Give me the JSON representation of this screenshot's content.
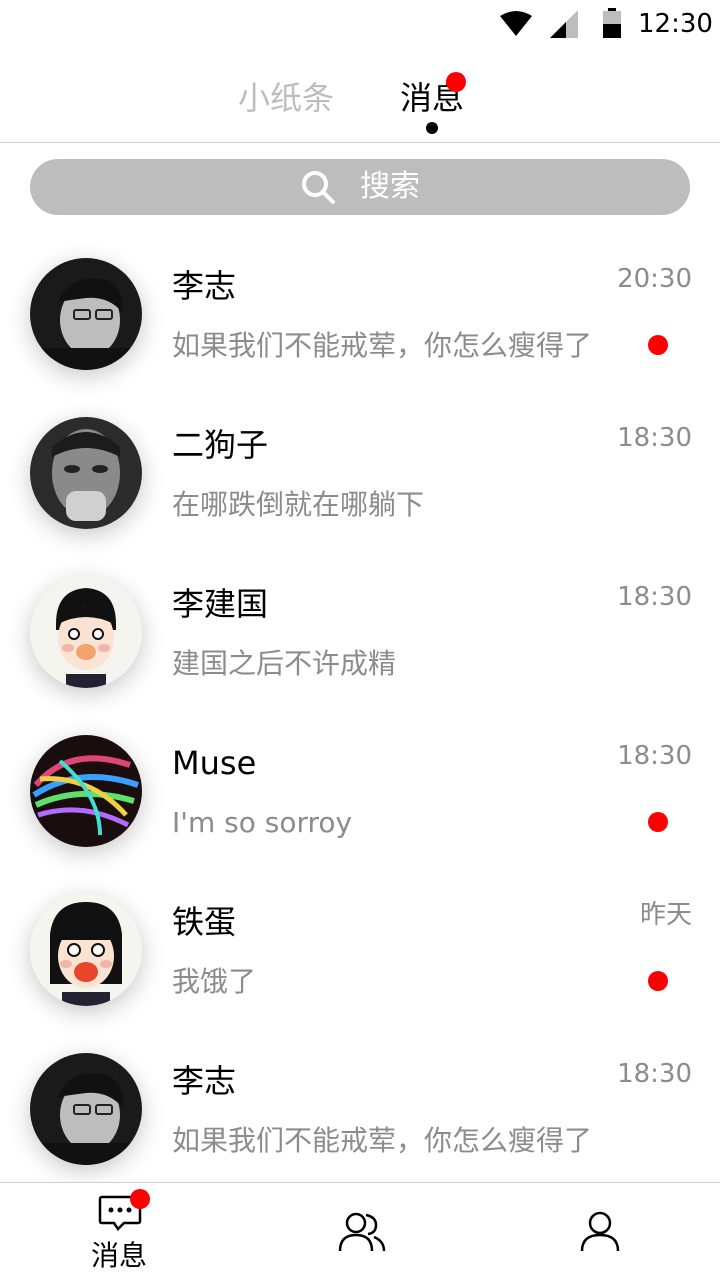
{
  "status_bar": {
    "time": "12:30"
  },
  "top_tabs": [
    {
      "label": "小纸条",
      "active": false
    },
    {
      "label": "消息",
      "active": true,
      "badge": true
    }
  ],
  "search": {
    "label": "搜索"
  },
  "conversations": [
    {
      "name": "李志",
      "time": "20:30",
      "preview": "如果我们不能戒荤，你怎么瘦得了",
      "unread": true,
      "avatar": "man-glasses-photo"
    },
    {
      "name": "二狗子",
      "time": "18:30",
      "preview": "在哪跌倒就在哪躺下",
      "unread": false,
      "avatar": "man-hand-face-photo"
    },
    {
      "name": "李建国",
      "time": "18:30",
      "preview": "建国之后不许成精",
      "unread": false,
      "avatar": "cartoon-boy"
    },
    {
      "name": "Muse",
      "time": "18:30",
      "preview": "I'm so sorroy",
      "unread": true,
      "avatar": "colorful-brain-art"
    },
    {
      "name": "铁蛋",
      "time": "昨天",
      "preview": "我饿了",
      "unread": true,
      "avatar": "cartoon-girl"
    },
    {
      "name": "李志",
      "time": "18:30",
      "preview": "如果我们不能戒荤，你怎么瘦得了",
      "unread": false,
      "avatar": "man-glasses-photo"
    }
  ],
  "bottom_nav": [
    {
      "label": "消息",
      "icon": "chat-bubble-icon",
      "badge": true,
      "active": true
    },
    {
      "label": "",
      "icon": "contacts-icon",
      "badge": false,
      "active": false
    },
    {
      "label": "",
      "icon": "profile-icon",
      "badge": false,
      "active": false
    }
  ],
  "colors": {
    "badge": "#ff0000",
    "muted": "#8c8c8c",
    "search_bg": "#bdbdbd",
    "inactive_tab": "#bdbdbd"
  }
}
